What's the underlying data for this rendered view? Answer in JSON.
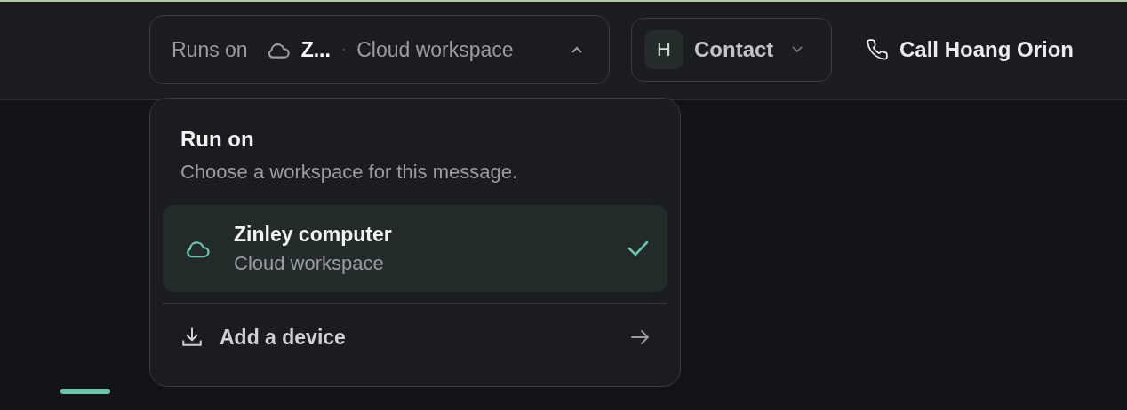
{
  "header": {
    "runs_on": {
      "label": "Runs on",
      "device": "Z...",
      "separator": "·",
      "workspace": "Cloud workspace",
      "expanded": true
    },
    "contact": {
      "avatar": "H",
      "label": "Contact"
    },
    "call": {
      "label": "Call Hoang Orion"
    }
  },
  "menu": {
    "title": "Run on",
    "subtitle": "Choose a workspace for this message.",
    "options": [
      {
        "name": "Zinley computer",
        "type": "Cloud workspace",
        "selected": true
      }
    ],
    "action": {
      "label": "Add a device"
    }
  }
}
